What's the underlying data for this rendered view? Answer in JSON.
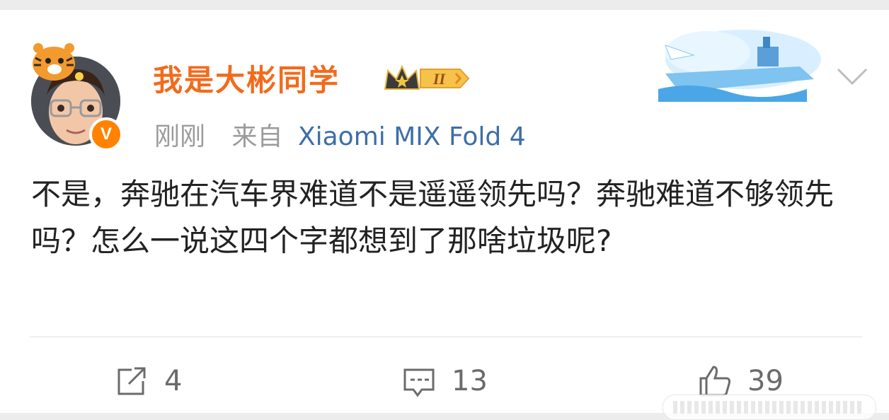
{
  "post": {
    "author": {
      "name": "我是大彬同学",
      "verified_badge": "V",
      "level_badge": "II"
    },
    "meta": {
      "time": "刚刚",
      "source_label": "来自",
      "device": "Xiaomi MIX Fold 4"
    },
    "text": "不是，奔驰在汽车界难道不是遥遥领先吗？奔驰难道不够领先吗？怎么一说这四个字都想到了那啥垃圾呢?",
    "actions": {
      "repost_count": "4",
      "comment_count": "13",
      "like_count": "39"
    }
  },
  "icons": {
    "menu": "chevron-down-icon",
    "repost": "share-icon",
    "comment": "comment-icon",
    "like": "thumbs-up-icon"
  },
  "colors": {
    "username": "#f26b1d",
    "device_link": "#3d6ea8",
    "meta_gray": "#9b9b9b",
    "verified_orange": "#ff8200"
  }
}
